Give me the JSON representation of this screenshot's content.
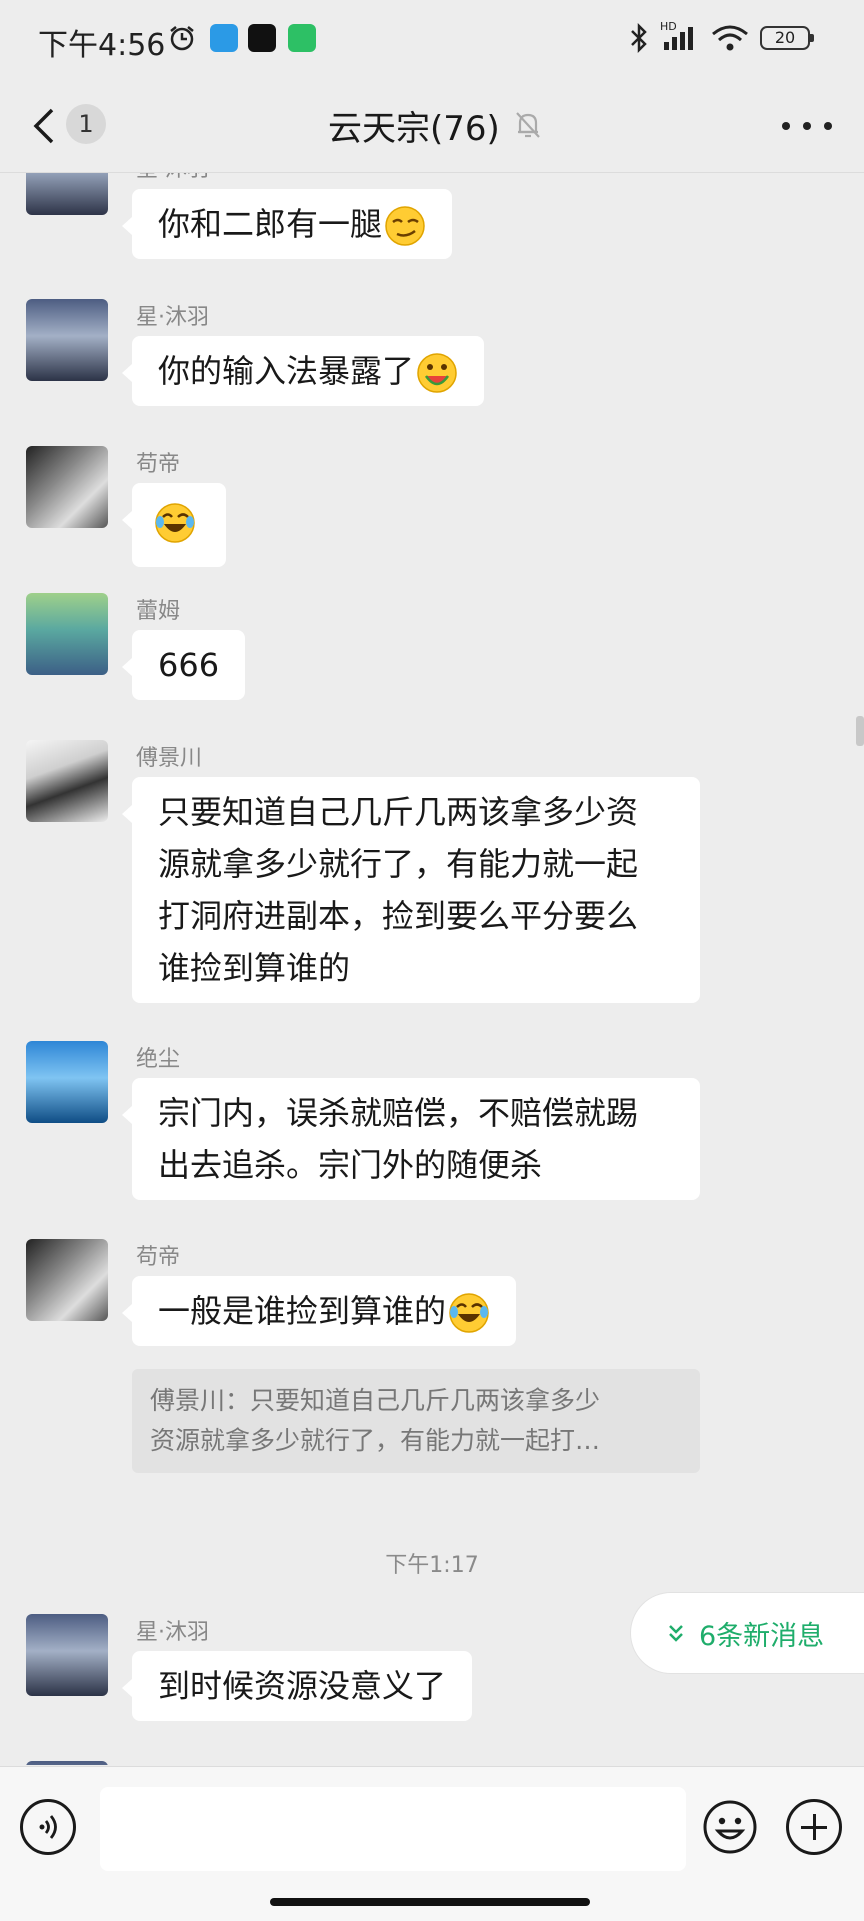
{
  "status_bar": {
    "time": "下午4:56",
    "battery": "20",
    "network_label": "HD"
  },
  "header": {
    "unread_count": "1",
    "title": "云天宗(76)"
  },
  "messages": [
    {
      "sender": "星·沐羽",
      "text": "你和二郎有一腿",
      "emoji": "smirk-emoji"
    },
    {
      "sender": "星·沐羽",
      "text": "你的输入法暴露了",
      "emoji": "watermelon-eating-emoji"
    },
    {
      "sender": "苟帝",
      "text": "",
      "emoji": "tears-of-joy-emoji"
    },
    {
      "sender": "蕾姆",
      "text": "666"
    },
    {
      "sender": "傅景川",
      "lines": [
        "只要知道自己几斤几两该拿多少资",
        "源就拿多少就行了，有能力就一起",
        "打洞府进副本，捡到要么平分要么",
        "谁捡到算谁的"
      ]
    },
    {
      "sender": "绝尘",
      "lines": [
        "宗门内，误杀就赔偿，不赔偿就踢",
        "出去追杀。宗门外的随便杀"
      ]
    },
    {
      "sender": "苟帝",
      "text": "一般是谁捡到算谁的",
      "emoji": "tears-of-joy-emoji",
      "quote": {
        "line1": "傅景川：只要知道自己几斤几两该拿多少",
        "line2": "资源就拿多少就行了，有能力就一起打…"
      }
    },
    {
      "sender": "星·沐羽",
      "text": "到时候资源没意义了"
    }
  ],
  "timestamp": "下午1:17",
  "new_messages_label": "6条新消息",
  "colors": {
    "accent_green": "#1fad6b",
    "bubble": "#ffffff",
    "background": "#ededed"
  }
}
